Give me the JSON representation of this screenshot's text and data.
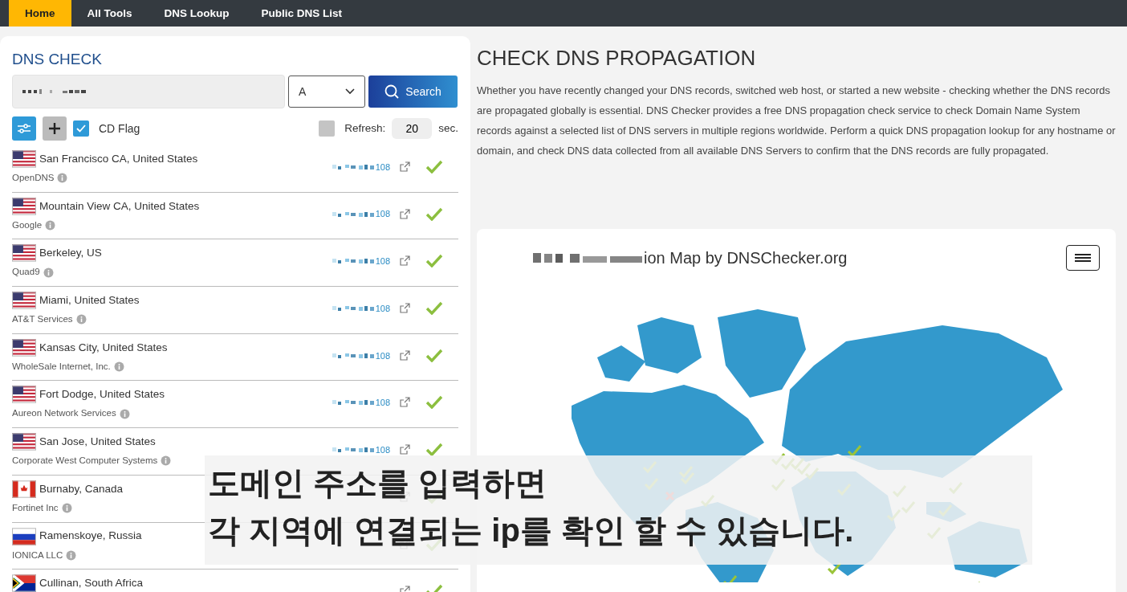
{
  "nav": [
    {
      "label": "Home",
      "selected": true
    },
    {
      "label": "All Tools",
      "selected": false
    },
    {
      "label": "DNS Lookup",
      "selected": false
    },
    {
      "label": "Public DNS List",
      "selected": false
    }
  ],
  "dns_check": {
    "title": "DNS CHECK",
    "record_type": "A",
    "search_button": "Search",
    "cd_flag": {
      "label": "CD Flag",
      "checked": true
    },
    "refresh": {
      "checked": false,
      "label": "Refresh:",
      "value": "20",
      "unit": "sec."
    }
  },
  "results": [
    {
      "kind": "us",
      "location": "San Francisco CA, United States",
      "provider": "OpenDNS",
      "ip": "108",
      "ok": true
    },
    {
      "kind": "us",
      "location": "Mountain View CA, United States",
      "provider": "Google",
      "ip": "108",
      "ok": true
    },
    {
      "kind": "us",
      "location": "Berkeley, US",
      "provider": "Quad9",
      "ip": "108",
      "ok": true
    },
    {
      "kind": "us",
      "location": "Miami, United States",
      "provider": "AT&T Services",
      "ip": "108",
      "ok": true
    },
    {
      "kind": "us",
      "location": "Kansas City, United States",
      "provider": "WholeSale Internet, Inc.",
      "ip": "108",
      "ok": true
    },
    {
      "kind": "us",
      "location": "Fort Dodge, United States",
      "provider": "Aureon Network Services",
      "ip": "108",
      "ok": true
    },
    {
      "kind": "us",
      "location": "San Jose, United States",
      "provider": "Corporate West Computer Systems",
      "ip": "108",
      "ok": true
    },
    {
      "kind": "ca",
      "location": "Burnaby, Canada",
      "provider": "Fortinet Inc",
      "ok": true
    },
    {
      "kind": "ru",
      "location": "Ramenskoye, Russia",
      "provider": "IONICA LLC",
      "ok": true
    },
    {
      "kind": "za",
      "location": "Cullinan, South Africa",
      "ok": true
    }
  ],
  "intro": {
    "title": "CHECK DNS PROPAGATION",
    "text": "Whether you have recently changed your DNS records, switched web host, or started a new website - checking whether the DNS records are propagated globally is essential. DNS Checker provides a free DNS propagation check service to check Domain Name System records against a selected list of DNS servers in multiple regions worldwide. Perform a quick DNS propagation lookup for any hostname or domain, and check DNS data collected from all available DNS Servers to confirm that the DNS records are fully propagated."
  },
  "map": {
    "title": "ion Map by DNSChecker.org"
  },
  "caption": [
    "도메인 주소를 입력하면",
    "각 지역에 연결되는 ip를 확인 할 수 있습니다."
  ]
}
